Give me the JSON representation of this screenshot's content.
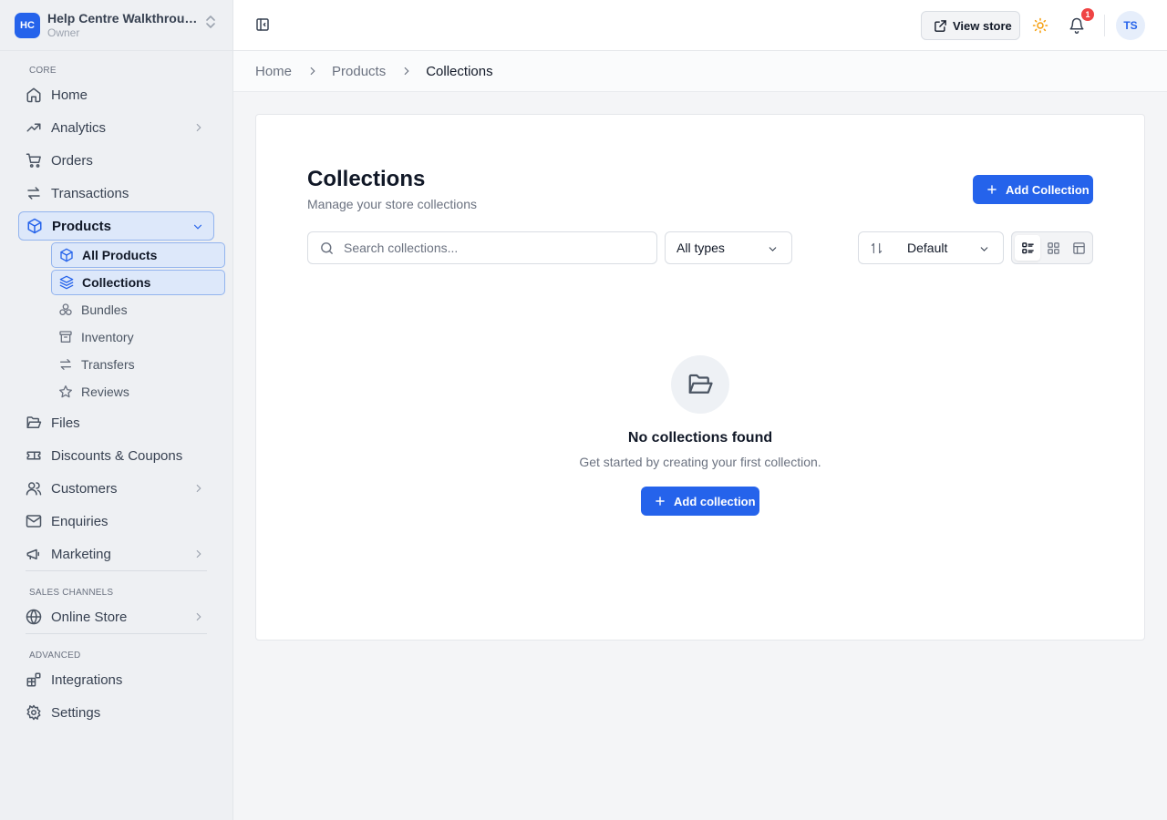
{
  "workspace": {
    "initials": "HC",
    "name": "Help Centre Walkthrough",
    "role": "Owner"
  },
  "sidebar": {
    "sections": {
      "core": "CORE",
      "sales": "SALES CHANNELS",
      "advanced": "ADVANCED"
    },
    "items": {
      "home": "Home",
      "analytics": "Analytics",
      "orders": "Orders",
      "transactions": "Transactions",
      "products": "Products",
      "files": "Files",
      "discounts": "Discounts & Coupons",
      "customers": "Customers",
      "enquiries": "Enquiries",
      "marketing": "Marketing",
      "online_store": "Online Store",
      "integrations": "Integrations",
      "settings": "Settings"
    },
    "product_sub": {
      "all_products": "All Products",
      "collections": "Collections",
      "bundles": "Bundles",
      "inventory": "Inventory",
      "transfers": "Transfers",
      "reviews": "Reviews"
    }
  },
  "topbar": {
    "view_store": "View store",
    "notification_count": "1",
    "avatar": "TS"
  },
  "breadcrumb": {
    "home": "Home",
    "products": "Products",
    "current": "Collections"
  },
  "page": {
    "title": "Collections",
    "subtitle": "Manage your store collections",
    "add_button": "Add Collection",
    "search_placeholder": "Search collections...",
    "type_filter": "All types",
    "sort": "Default"
  },
  "empty": {
    "title": "No collections found",
    "description": "Get started by creating your first collection.",
    "button": "Add collection"
  },
  "colors": {
    "accent": "#2563eb",
    "badge": "#ef4444"
  }
}
